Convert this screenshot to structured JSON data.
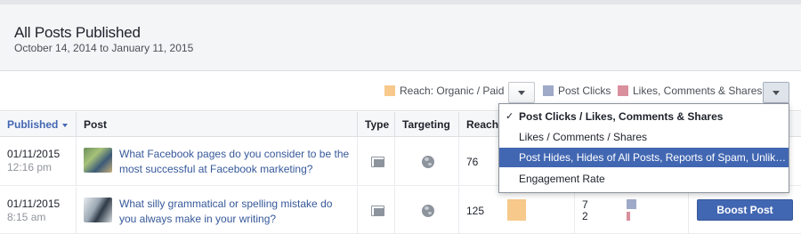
{
  "header": {
    "title": "All Posts Published",
    "date_range": "October 14, 2014 to January 11, 2015"
  },
  "legend": {
    "reach": {
      "label": "Reach: Organic / Paid",
      "color": "#f7c98b"
    },
    "clicks": {
      "label": "Post Clicks",
      "color": "#9fa9c8"
    },
    "likes": {
      "label": "Likes, Comments & Shares",
      "color": "#d98f9c"
    }
  },
  "columns": {
    "published": "Published",
    "post": "Post",
    "type": "Type",
    "targeting": "Targeting",
    "reach": "Reach"
  },
  "rows": [
    {
      "date": "01/11/2015",
      "time": "12:16 pm",
      "text": "What Facebook pages do you consider to be the most successful at Facebook marketing?",
      "reach": "76"
    },
    {
      "date": "01/11/2015",
      "time": "8:15 am",
      "text": "What silly grammatical or spelling mistake do you always make in your writing?",
      "reach": "125",
      "clicks": "7",
      "likes": "2",
      "boost_label": "Boost Post"
    }
  ],
  "menu": {
    "items": [
      {
        "label": "Post Clicks / Likes, Comments & Shares",
        "selected": true
      },
      {
        "label": "Likes / Comments / Shares"
      },
      {
        "label": "Post Hides, Hides of All Posts, Reports of Spam, Unlikes of Page",
        "highlighted": true
      },
      {
        "label": "Engagement Rate"
      }
    ],
    "check_glyph": "✓"
  },
  "icons": [
    "sort-caret-icon",
    "dropdown-caret-icon",
    "multi-photo-icon",
    "globe-icon",
    "check-icon"
  ]
}
